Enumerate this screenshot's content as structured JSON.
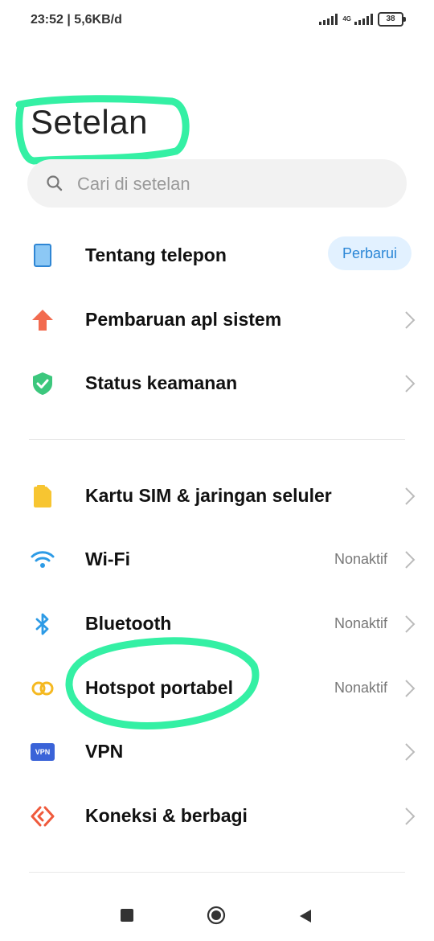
{
  "status": {
    "time": "23:52 | 5,6KB/d",
    "network_type": "4G",
    "battery": "38"
  },
  "title": "Setelan",
  "search": {
    "placeholder": "Cari di setelan"
  },
  "sections": [
    {
      "items": [
        {
          "name": "about-phone",
          "label": "Tentang telepon",
          "icon": "phone-icon",
          "button": "Perbarui"
        },
        {
          "name": "system-app-updates",
          "label": "Pembaruan apl sistem",
          "icon": "arrow-up-icon"
        },
        {
          "name": "security-status",
          "label": "Status keamanan",
          "icon": "shield-check-icon"
        }
      ]
    },
    {
      "items": [
        {
          "name": "sim-cards",
          "label": "Kartu SIM & jaringan seluler",
          "icon": "sim-card-icon"
        },
        {
          "name": "wifi",
          "label": "Wi-Fi",
          "value": "Nonaktif",
          "icon": "wifi-icon"
        },
        {
          "name": "bluetooth",
          "label": "Bluetooth",
          "value": "Nonaktif",
          "icon": "bluetooth-icon"
        },
        {
          "name": "hotspot",
          "label": "Hotspot portabel",
          "value": "Nonaktif",
          "icon": "hotspot-icon"
        },
        {
          "name": "vpn",
          "label": "VPN",
          "icon": "vpn-icon",
          "icon_text": "VPN"
        },
        {
          "name": "connection-sharing",
          "label": "Koneksi & berbagi",
          "icon": "share-connection-icon"
        }
      ]
    }
  ],
  "colors": {
    "highlight": "#34f0a4",
    "accent": "#2a86d6",
    "update_bg": "#e2f1ff"
  }
}
